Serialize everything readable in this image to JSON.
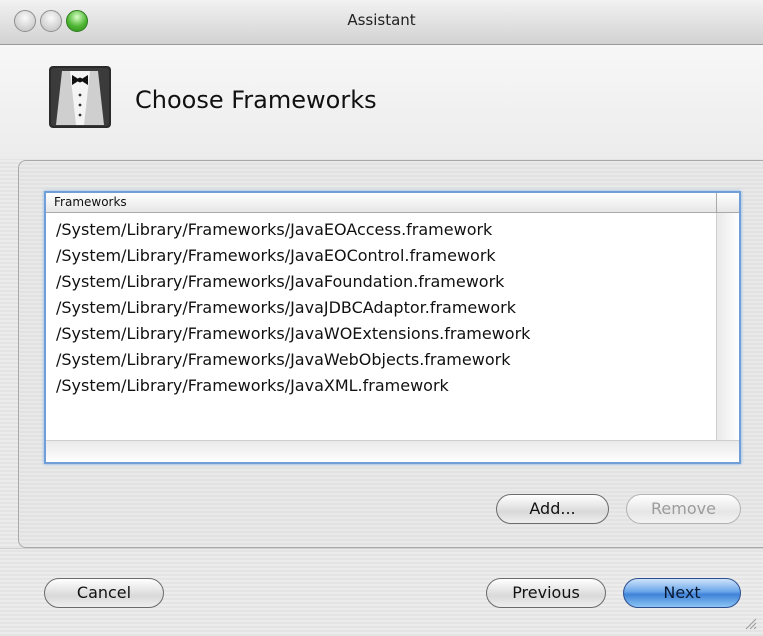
{
  "window": {
    "title": "Assistant"
  },
  "header": {
    "title": "Choose Frameworks",
    "logo_icon": "tuxedo-icon"
  },
  "frameworks_table": {
    "column_header": "Frameworks",
    "rows": [
      "/System/Library/Frameworks/JavaEOAccess.framework",
      "/System/Library/Frameworks/JavaEOControl.framework",
      "/System/Library/Frameworks/JavaFoundation.framework",
      "/System/Library/Frameworks/JavaJDBCAdaptor.framework",
      "/System/Library/Frameworks/JavaWOExtensions.framework",
      "/System/Library/Frameworks/JavaWebObjects.framework",
      "/System/Library/Frameworks/JavaXML.framework"
    ]
  },
  "buttons": {
    "add": "Add...",
    "remove": "Remove",
    "cancel": "Cancel",
    "previous": "Previous",
    "next": "Next"
  },
  "colors": {
    "accent": "#4a8fe0",
    "focus_ring": "#6f9fd6"
  }
}
